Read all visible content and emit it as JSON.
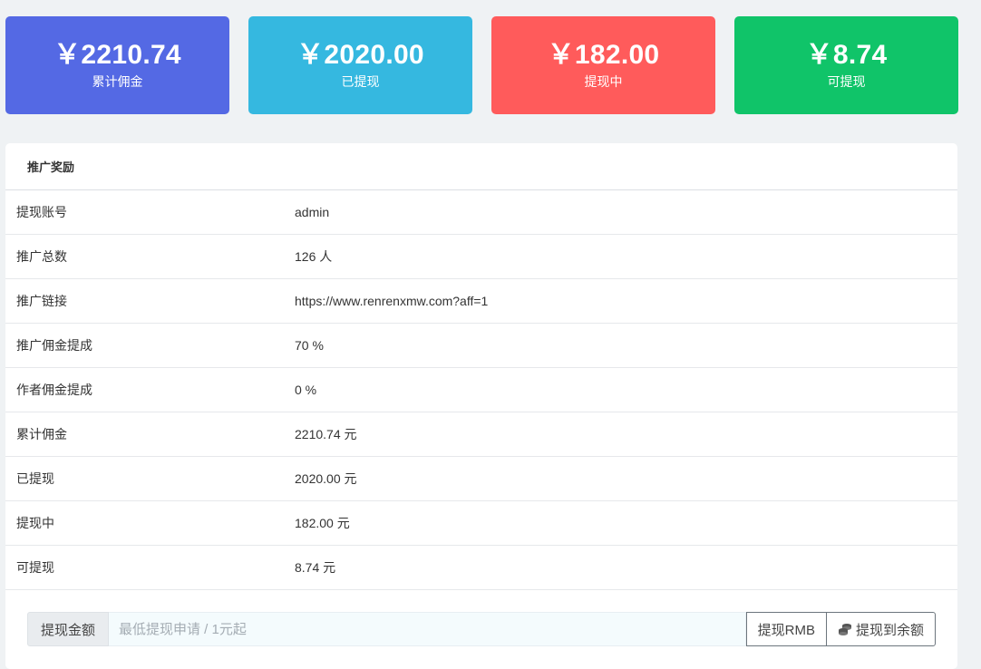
{
  "stats": [
    {
      "amount": "￥2210.74",
      "label": "累计佣金",
      "color": "#5469e4"
    },
    {
      "amount": "￥2020.00",
      "label": "已提现",
      "color": "#35b8e0"
    },
    {
      "amount": "￥182.00",
      "label": "提现中",
      "color": "#ff5b5b"
    },
    {
      "amount": "￥8.74",
      "label": "可提现",
      "color": "#10c469"
    }
  ],
  "panel": {
    "title": "推广奖励",
    "rows": [
      {
        "key": "提现账号",
        "value": "admin"
      },
      {
        "key": "推广总数",
        "value": "126 人"
      },
      {
        "key": "推广链接",
        "value": "https://www.renrenxmw.com?aff=1"
      },
      {
        "key": "推广佣金提成",
        "value": "70 %"
      },
      {
        "key": "作者佣金提成",
        "value": "0 %"
      },
      {
        "key": "累计佣金",
        "value": "2210.74 元"
      },
      {
        "key": "已提现",
        "value": "2020.00 元"
      },
      {
        "key": "提现中",
        "value": "182.00 元"
      },
      {
        "key": "可提现",
        "value": "8.74 元"
      }
    ]
  },
  "withdraw": {
    "label": "提现金额",
    "placeholder": "最低提现申请 / 1元起",
    "rmb_button": "提现RMB",
    "balance_button": "提现到余额",
    "balance_icon": "coins-icon"
  }
}
